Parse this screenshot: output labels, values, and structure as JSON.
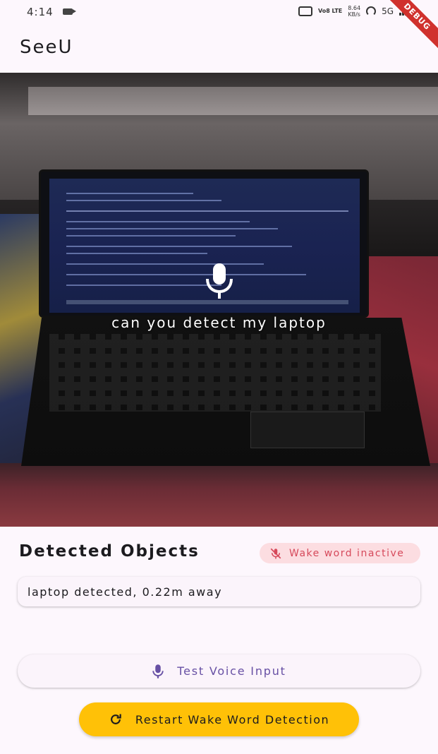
{
  "status_bar": {
    "time": "4:14",
    "network_volte": "Vo8 LTE",
    "speed_value": "8.64",
    "speed_unit": "KB/s",
    "network_type": "5G",
    "debug_label": "DEBUG"
  },
  "app_bar": {
    "title": "SeeU"
  },
  "camera_preview": {
    "transcript": "can you detect my laptop",
    "mic_icon": "mic-icon"
  },
  "detected_section": {
    "title": "Detected Objects",
    "wake_status": {
      "label": "Wake word inactive",
      "icon": "mic-off-icon",
      "color": "#d6495b",
      "background": "#fcdde1"
    },
    "detections": [
      {
        "text": "laptop detected, 0.22m away"
      }
    ]
  },
  "actions": {
    "test_voice": {
      "label": "Test Voice Input",
      "icon": "mic-icon",
      "color": "#6750a4"
    },
    "restart": {
      "label": "Restart Wake Word Detection",
      "icon": "refresh-icon",
      "color": "#ffc107"
    }
  }
}
